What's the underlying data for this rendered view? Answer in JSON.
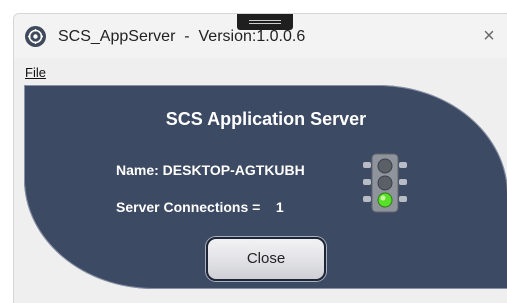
{
  "window": {
    "title": "SCS_AppServer  -  Version:1.0.0.6",
    "close_glyph": "×",
    "icon": "app-gear-icon"
  },
  "menu": {
    "file_label": "File"
  },
  "panel": {
    "title": "SCS Application Server",
    "name_line": "Name: DESKTOP-AGTKUBH",
    "connections_line": "Server Connections =    1",
    "status_icon": "traffic-light-icon",
    "status_light": "green",
    "close_button": "Close"
  },
  "colors": {
    "panel_bg": "#3d4a63",
    "status_green": "#59e02a"
  }
}
